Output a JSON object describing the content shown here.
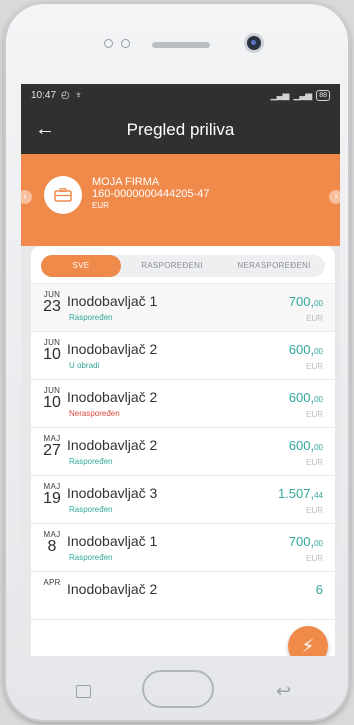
{
  "statusbar": {
    "time": "10:47",
    "battery": "88"
  },
  "appbar": {
    "title": "Pregled priliva"
  },
  "account": {
    "name": "MOJA FIRMA",
    "number": "160-0000000444205-47",
    "currency": "EUR"
  },
  "tabs": [
    {
      "label": "SVE",
      "active": true
    },
    {
      "label": "RASPOREĐENI",
      "active": false
    },
    {
      "label": "NERASPOREĐENI",
      "active": false
    }
  ],
  "transactions": [
    {
      "month": "JUN",
      "day": "23",
      "name": "Inodobavljač 1",
      "status": "Raspoređen",
      "status_color": "#34a89b",
      "amount_int": "700,",
      "amount_dec": "00",
      "currency": "EUR"
    },
    {
      "month": "JUN",
      "day": "10",
      "name": "Inodobavljač 2",
      "status": "U obradi",
      "status_color": "#34a89b",
      "amount_int": "600,",
      "amount_dec": "00",
      "currency": "EUR"
    },
    {
      "month": "JUN",
      "day": "10",
      "name": "Inodobavljač 2",
      "status": "Neraspoređen",
      "status_color": "#d9453a",
      "amount_int": "600,",
      "amount_dec": "00",
      "currency": "EUR"
    },
    {
      "month": "MAJ",
      "day": "27",
      "name": "Inodobavljač 2",
      "status": "Raspoređen",
      "status_color": "#34a89b",
      "amount_int": "600,",
      "amount_dec": "00",
      "currency": "EUR"
    },
    {
      "month": "MAJ",
      "day": "19",
      "name": "Inodobavljač 3",
      "status": "Raspoređen",
      "status_color": "#34a89b",
      "amount_int": "1.507,",
      "amount_dec": "44",
      "currency": "EUR"
    },
    {
      "month": "MAJ",
      "day": "8",
      "name": "Inodobavljač 1",
      "status": "Raspoređen",
      "status_color": "#34a89b",
      "amount_int": "700,",
      "amount_dec": "00",
      "currency": "EUR"
    },
    {
      "month": "APR",
      "day": "",
      "name": "Inodobavljač 2",
      "status": "",
      "status_color": "#34a89b",
      "amount_int": "6",
      "amount_dec": "",
      "currency": ""
    }
  ],
  "icons": {
    "back": "arrow-left-icon",
    "account": "briefcase-icon",
    "fab": "lightning-icon"
  },
  "colors": {
    "accent": "#f08a4b",
    "dark": "#2e312f",
    "teal": "#34a89b",
    "red": "#d9453a"
  }
}
